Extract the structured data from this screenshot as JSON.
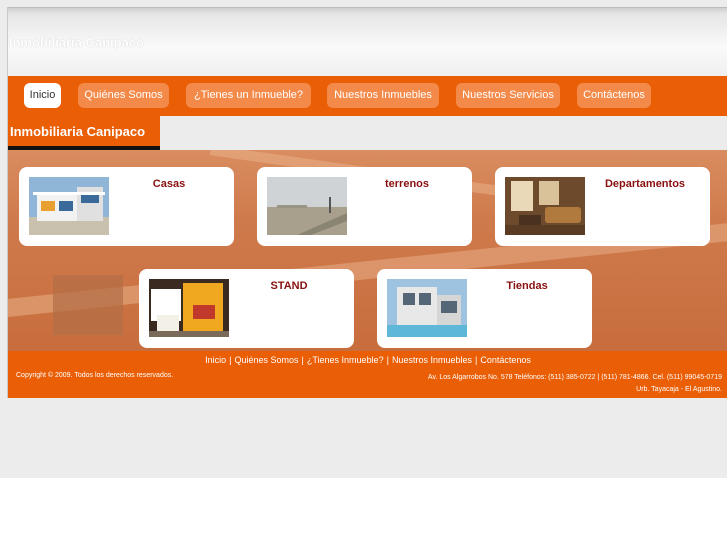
{
  "header": {
    "site_title": "Inmobiliaria Canipaco"
  },
  "nav": {
    "items": [
      {
        "label": "Inicio"
      },
      {
        "label": "Quiénes Somos"
      },
      {
        "label": "¿Tienes un Inmueble?"
      },
      {
        "label": "Nuestros Inmuebles"
      },
      {
        "label": "Nuestros Servicios"
      },
      {
        "label": "Contáctenos"
      }
    ],
    "active": "Inicio"
  },
  "section": {
    "title": "Inmobiliaria Canipaco"
  },
  "categories": [
    {
      "label": "Casas",
      "image": "house-photo"
    },
    {
      "label": "terrenos",
      "image": "land-photo"
    },
    {
      "label": "Departamentos",
      "image": "apartment-photo"
    },
    {
      "label": "STAND",
      "image": "stand-photo"
    },
    {
      "label": "Tiendas",
      "image": "store-photo"
    }
  ],
  "footer": {
    "links": [
      "Inicio",
      "Quiénes Somos",
      "¿Tienes Inmueble?",
      "Nuestros Inmuebles",
      "Contáctenos"
    ],
    "separator": "|",
    "copyright": "Copyright © 2009. Todos los derechos reservados.",
    "address_line1": "Av. Los Algarrobos No. 578 Teléfonos: (511) 385-0722 | (511) 781-4866. Cel. (511) 99045-0719",
    "address_line2": "Urb. Tayacaja - El Agustino."
  },
  "colors": {
    "brand_orange": "#ea5e06",
    "tab_orange": "#f38a4a",
    "label_red": "#8a1010"
  }
}
